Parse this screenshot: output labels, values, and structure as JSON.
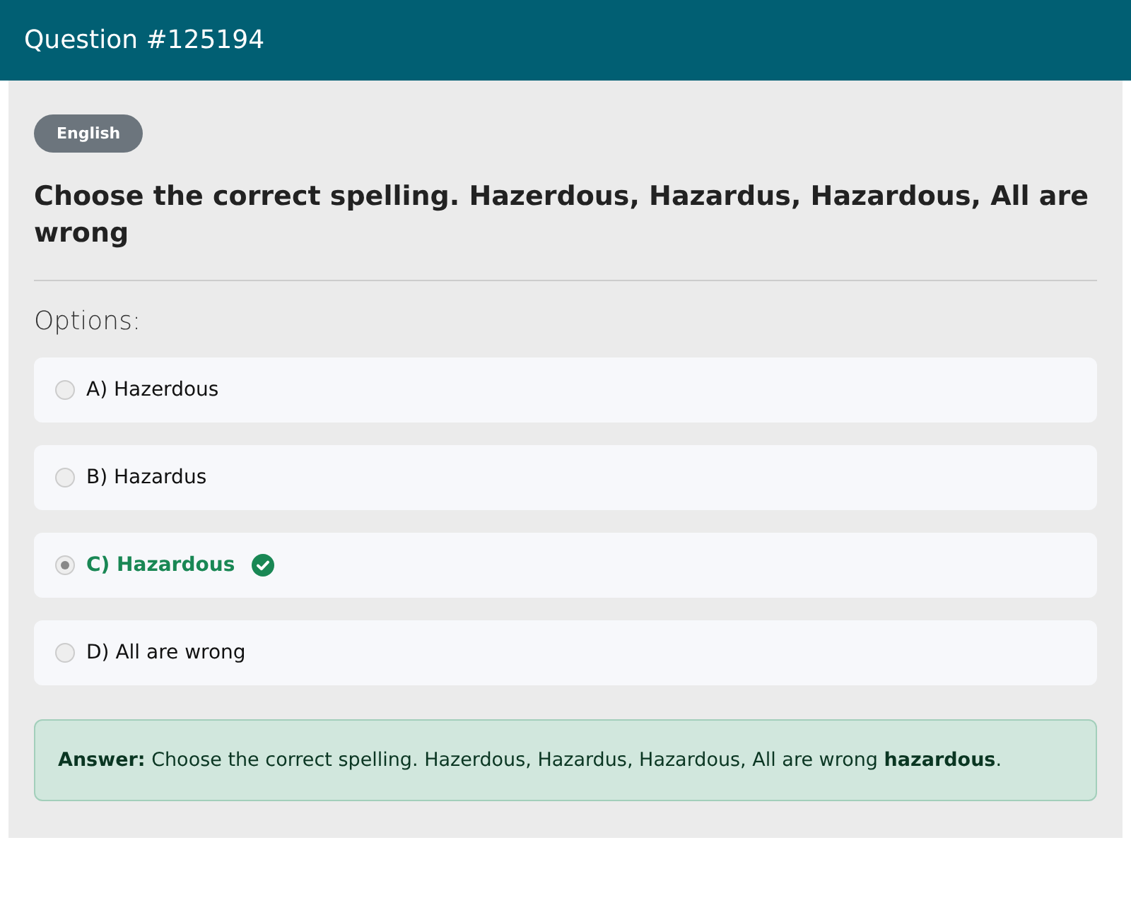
{
  "header": {
    "title": "Question #125194"
  },
  "badge": "English",
  "question": "Choose the correct spelling. Hazerdous, Hazardus, Hazardous, All are wrong",
  "options_label": "Options:",
  "options": [
    {
      "label": "A) Hazerdous",
      "selected": false,
      "correct": false
    },
    {
      "label": "B) Hazardus",
      "selected": false,
      "correct": false
    },
    {
      "label": "C) Hazardous",
      "selected": true,
      "correct": true
    },
    {
      "label": "D) All are wrong",
      "selected": false,
      "correct": false
    }
  ],
  "answer": "**Answer:** Choose the correct spelling. Hazerdous, Hazardus, Hazardous, All are wrong **hazardous**."
}
